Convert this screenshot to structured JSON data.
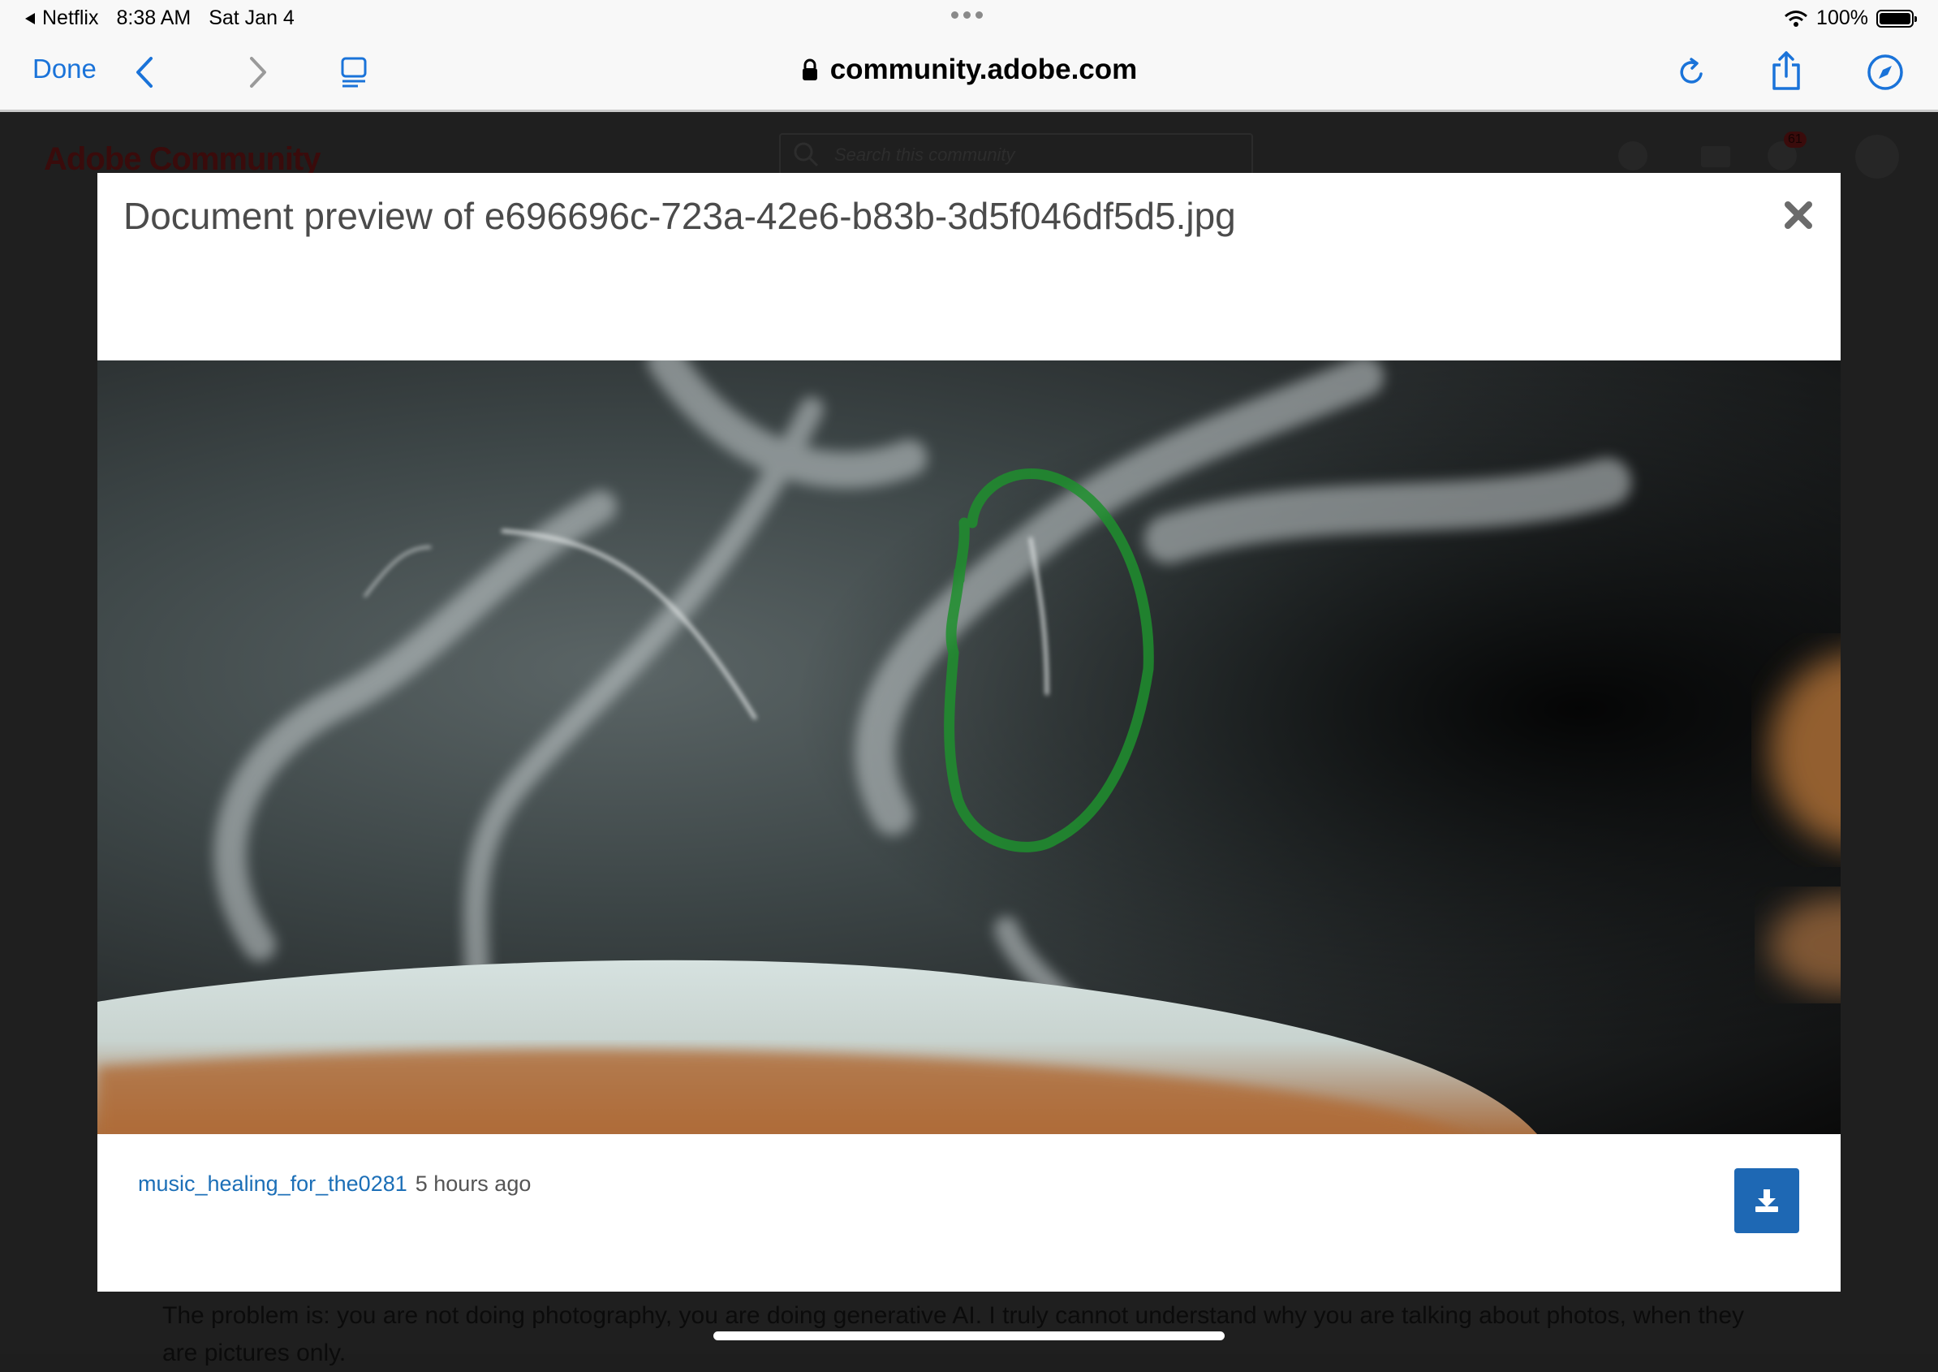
{
  "status_bar": {
    "back_app": "Netflix",
    "time": "8:38 AM",
    "date": "Sat Jan 4",
    "battery": "100%"
  },
  "toolbar": {
    "done_label": "Done",
    "url": "community.adobe.com"
  },
  "background_page": {
    "brand": "Adobe Community",
    "search_placeholder": "Search this community",
    "notification_count": "61",
    "post_text": "The problem is: you are not doing photography, you are doing generative AI. I truly cannot understand why you are talking about photos, when they are pictures only."
  },
  "modal": {
    "title": "Document preview of e696696c-723a-42e6-b83b-3d5f046df5d5.jpg",
    "author": "music_healing_for_the0281",
    "time_ago": "5 hours ago"
  },
  "colors": {
    "accent": "#1a73d9",
    "download_button": "#1e68b4",
    "author_link": "#1c6fb7",
    "annotation": "#1f8f2e"
  },
  "icons": [
    "back-chevron-icon",
    "forward-chevron-icon",
    "reader-icon",
    "lock-icon",
    "reload-icon",
    "share-icon",
    "compass-icon",
    "close-icon",
    "download-icon",
    "wifi-icon",
    "battery-icon"
  ]
}
